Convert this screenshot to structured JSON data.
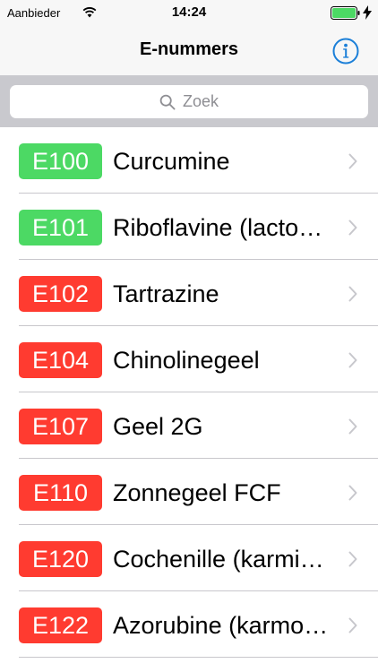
{
  "status_bar": {
    "carrier": "Aanbieder",
    "time": "14:24"
  },
  "nav": {
    "title": "E-nummers",
    "info_icon": "info-icon"
  },
  "search": {
    "placeholder": "Zoek"
  },
  "colors": {
    "green": "#4cd964",
    "red": "#ff3b30",
    "tint": "#1b7fd8"
  },
  "items": [
    {
      "code": "E100",
      "name": "Curcumine",
      "status": "green"
    },
    {
      "code": "E101",
      "name": "Riboflavine (lacto…",
      "status": "green"
    },
    {
      "code": "E102",
      "name": "Tartrazine",
      "status": "red"
    },
    {
      "code": "E104",
      "name": "Chinolinegeel",
      "status": "red"
    },
    {
      "code": "E107",
      "name": "Geel 2G",
      "status": "red"
    },
    {
      "code": "E110",
      "name": "Zonnegeel FCF",
      "status": "red"
    },
    {
      "code": "E120",
      "name": "Cochenille (karmi…",
      "status": "red"
    },
    {
      "code": "E122",
      "name": "Azorubine (karmo…",
      "status": "red"
    }
  ]
}
